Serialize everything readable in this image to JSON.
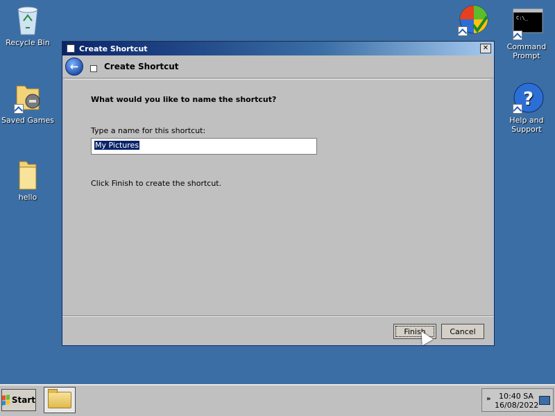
{
  "desktop": {
    "icons": [
      {
        "label": "Recycle Bin",
        "icon": "recycle-bin-icon"
      },
      {
        "label": "Saved Games",
        "icon": "saved-games-icon"
      },
      {
        "label": "hello",
        "icon": "folder-icon"
      },
      {
        "label": "",
        "icon": "windows-update-icon"
      },
      {
        "label": "Command Prompt",
        "icon": "command-prompt-icon"
      },
      {
        "label": "Help and Support",
        "icon": "help-support-icon"
      }
    ]
  },
  "window": {
    "title": "Create Shortcut",
    "close_glyph": "✕"
  },
  "wizard": {
    "header_title": "Create Shortcut",
    "back_glyph": "←",
    "question": "What would you like to name the shortcut?",
    "field_label": "Type a name for this shortcut:",
    "field_value": "My Pictures",
    "hint": "Click Finish to create the shortcut.",
    "finish_label": "Finish",
    "cancel_label": "Cancel"
  },
  "taskbar": {
    "start_label": "Start",
    "tray_chevron": "»",
    "time": "10:40 SA",
    "date": "16/08/2022"
  },
  "colors": {
    "desktop": "#3b6ea5",
    "titlebar": "#0a246a",
    "selection": "#0a246a"
  }
}
